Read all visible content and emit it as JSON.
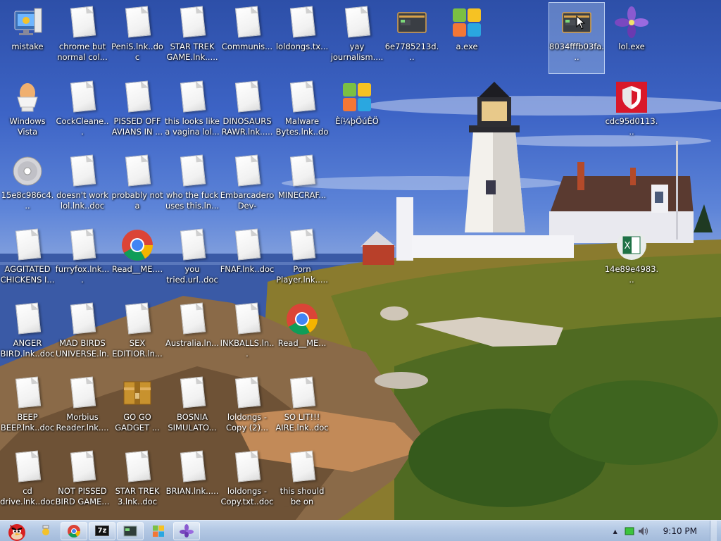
{
  "desktop": {
    "icons": [
      {
        "label": "mistake",
        "icon": "monitor-setup-icon",
        "selected": false
      },
      {
        "label": "chrome but normal col...",
        "icon": "document-icon"
      },
      {
        "label": "PeniS.lnk..doc",
        "icon": "document-icon"
      },
      {
        "label": "STAR TREK GAME.lnk.....",
        "icon": "document-icon"
      },
      {
        "label": "Communis...",
        "icon": "document-icon"
      },
      {
        "label": "loldongs.tx...",
        "icon": "document-icon"
      },
      {
        "label": "yay journalism....",
        "icon": "document-icon"
      },
      {
        "label": "6e7785213d...",
        "icon": "window-app-icon"
      },
      {
        "label": "a.exe",
        "icon": "windows-logo-icon"
      },
      {
        "label": "8034fffb03fa...",
        "icon": "window-app-icon",
        "selected": true
      },
      {
        "label": "lol.exe",
        "icon": "purple-flower-icon"
      },
      {
        "label": "Windows Vista",
        "icon": "egg-cup-icon"
      },
      {
        "label": "CockCleane...",
        "icon": "document-icon"
      },
      {
        "label": "PISSED OFF AVIANS IN ...",
        "icon": "document-icon"
      },
      {
        "label": "this looks like a vagina lol...",
        "icon": "document-icon"
      },
      {
        "label": "DINOSAURS RAWR.lnk.....",
        "icon": "document-icon"
      },
      {
        "label": "Malware Bytes.lnk..doc",
        "icon": "document-icon"
      },
      {
        "label": "Èí¼þÖúÊÖ",
        "icon": "windows-logo-icon"
      },
      {
        "label": "cdc95d0113...",
        "icon": "shield-icon"
      },
      {
        "label": "15e8c986c4...",
        "icon": "disc-icon"
      },
      {
        "label": "doesn't work lol.lnk..doc",
        "icon": "document-icon"
      },
      {
        "label": "probably not a rogue.lnk....",
        "icon": "document-icon"
      },
      {
        "label": "who the fuck uses this.ln...",
        "icon": "document-icon"
      },
      {
        "label": "Embarcadero Dev-C++.ln...",
        "icon": "document-icon"
      },
      {
        "label": "MINECRAF...",
        "icon": "document-icon"
      },
      {
        "label": "AGGITATED CHICKENS I...",
        "icon": "document-icon"
      },
      {
        "label": "furryfox.lnk....",
        "icon": "document-icon"
      },
      {
        "label": "Read__ME....",
        "icon": "chrome-icon"
      },
      {
        "label": "you tried.url..doc",
        "icon": "document-icon"
      },
      {
        "label": "FNAF.lnk..doc",
        "icon": "document-icon"
      },
      {
        "label": "Porn Player.lnk.....",
        "icon": "document-icon"
      },
      {
        "label": "14e89e4983...",
        "icon": "excel-icon"
      },
      {
        "label": "ANGER BIRD.lnk..doc",
        "icon": "document-icon"
      },
      {
        "label": "MAD BIRDS UNIVERSE.ln...",
        "icon": "document-icon"
      },
      {
        "label": "SEX EDITIOR.ln...",
        "icon": "document-icon"
      },
      {
        "label": "Australia.ln...",
        "icon": "document-icon"
      },
      {
        "label": "INKBALLS.ln...",
        "icon": "document-icon"
      },
      {
        "label": "Read__ME...",
        "icon": "chrome-icon"
      },
      {
        "label": "BEEP BEEP.lnk..doc",
        "icon": "document-icon"
      },
      {
        "label": "Morbius Reader.lnk....",
        "icon": "document-icon"
      },
      {
        "label": "GO GO GADGET ...",
        "icon": "folder-zip-icon"
      },
      {
        "label": "BOSNIA SIMULATO...",
        "icon": "document-icon"
      },
      {
        "label": "loldongs - Copy (2)...",
        "icon": "document-icon"
      },
      {
        "label": "SO LIT!!! AIRE.lnk..doc",
        "icon": "document-icon"
      },
      {
        "label": "cd drive.lnk..doc",
        "icon": "document-icon"
      },
      {
        "label": "NOT PISSED BIRD GAME...",
        "icon": "document-icon"
      },
      {
        "label": "STAR TREK 3.lnk..doc",
        "icon": "document-icon"
      },
      {
        "label": "BRIAN.lnk.....",
        "icon": "document-icon"
      },
      {
        "label": "loldongs - Copy.txt..doc",
        "icon": "document-icon"
      },
      {
        "label": "this should be on vinesauc...",
        "icon": "document-icon"
      }
    ]
  },
  "taskbar": {
    "start_icon": "angry-bird-start-icon",
    "buttons": [
      {
        "icon": "sun-icon"
      },
      {
        "icon": "chrome-icon"
      },
      {
        "icon": "sevenzip-icon",
        "text": "7z"
      },
      {
        "icon": "window-app-icon"
      },
      {
        "icon": "windows-logo-icon"
      },
      {
        "icon": "purple-flower-icon"
      }
    ],
    "tray": {
      "chevron": "▲",
      "clock": "9:10 PM"
    }
  },
  "colors": {
    "taskbar": "#b3c8e4",
    "sky": "#3d64c6"
  }
}
